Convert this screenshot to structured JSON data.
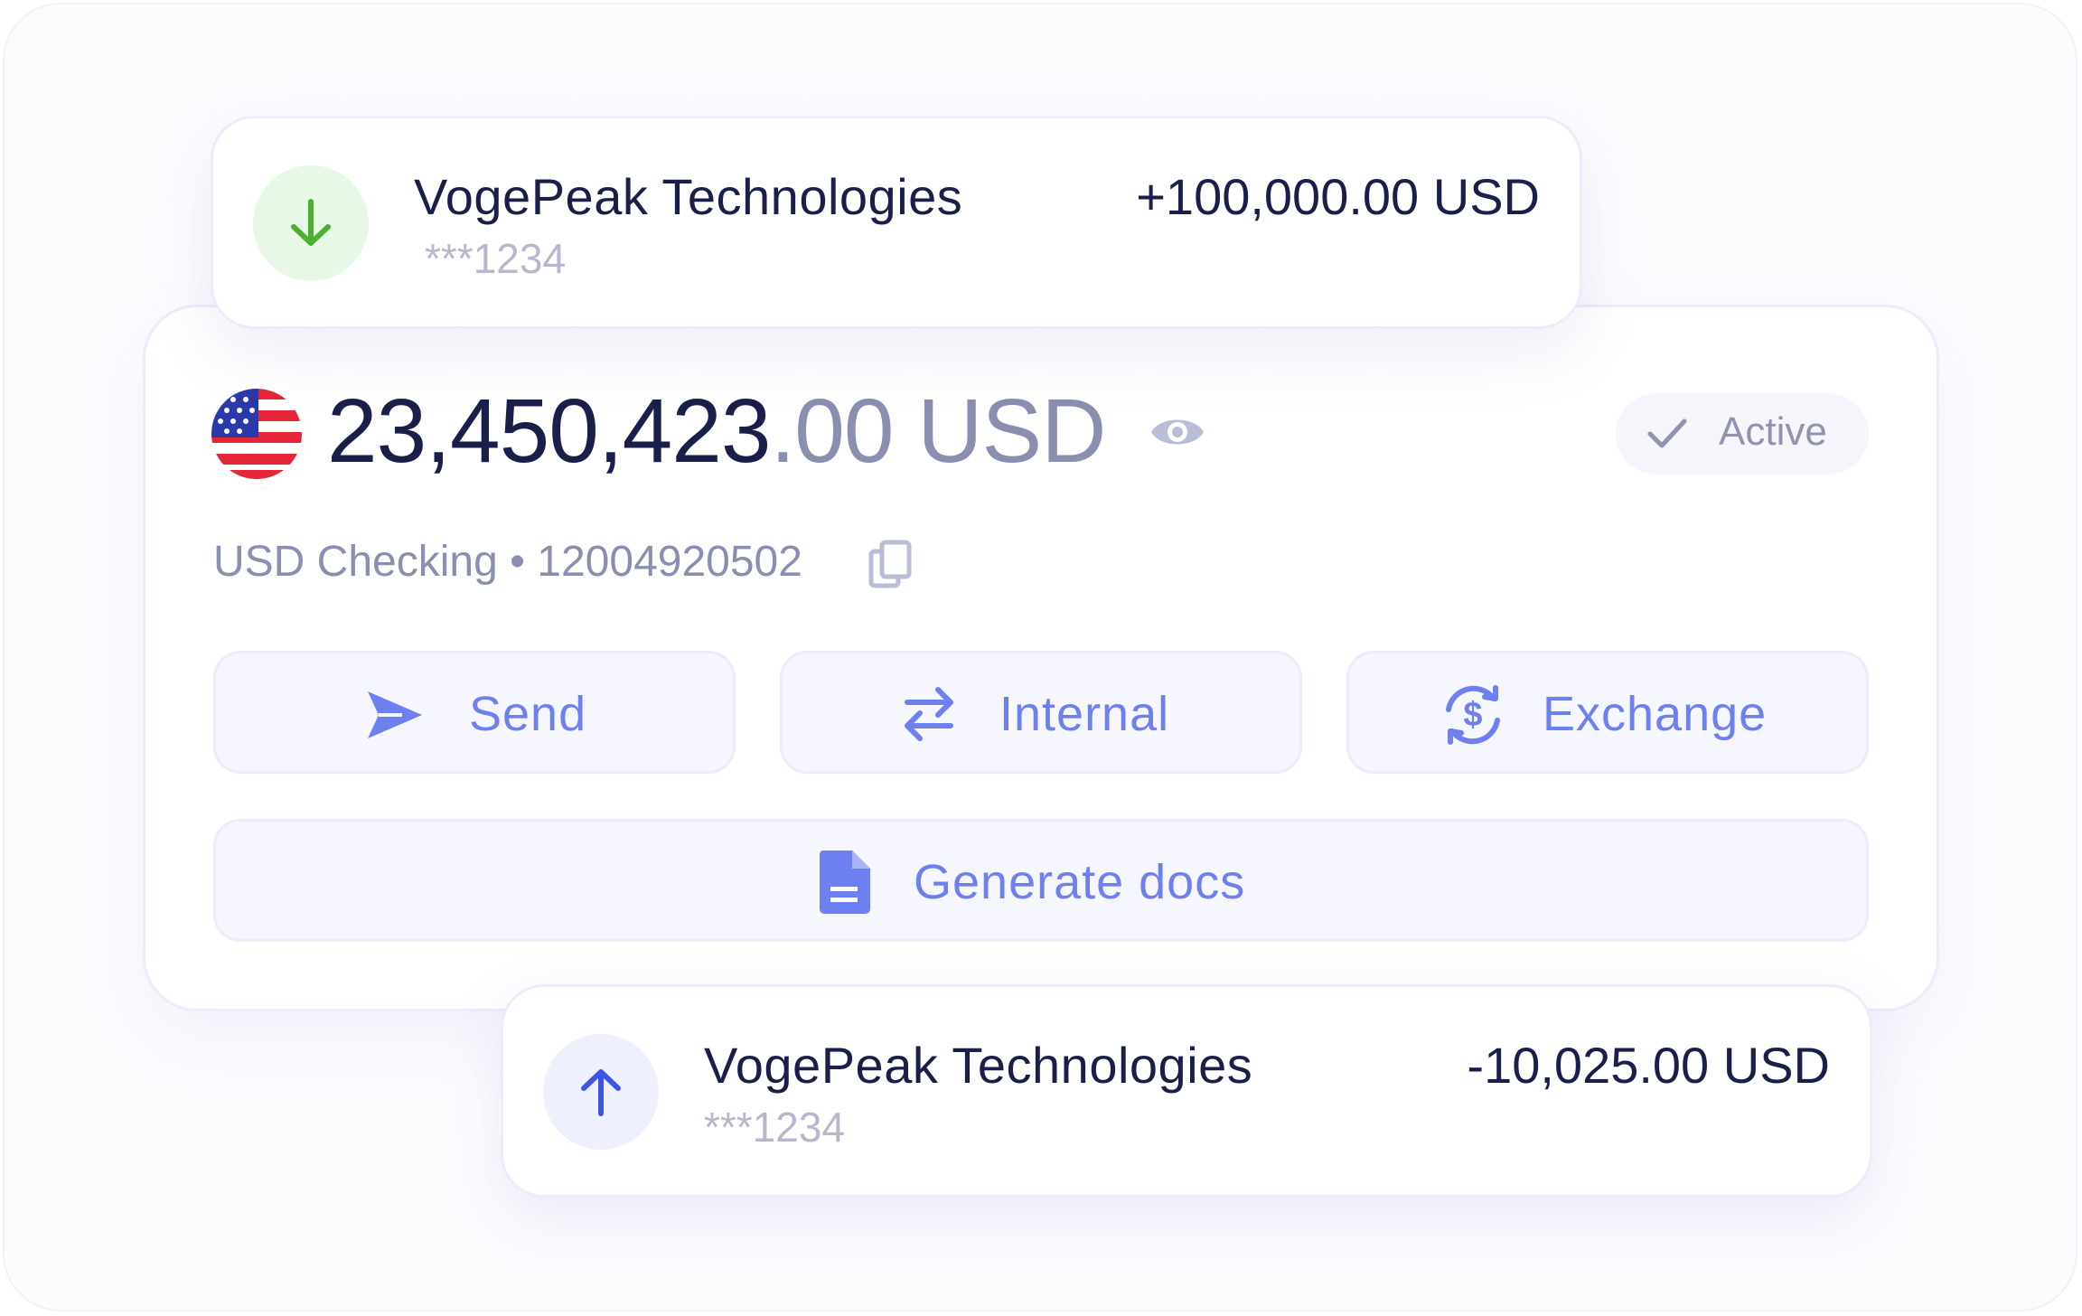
{
  "incoming_txn": {
    "name": "VogePeak Technologies",
    "account": "***1234",
    "amount": "+100,000.00 USD",
    "direction_icon": "arrow-down-icon",
    "accent": "#4caf30",
    "icon_bg": "#e8f8e6"
  },
  "account": {
    "flag_icon": "us-flag-icon",
    "balance_int": "23,450,423",
    "balance_dec": ".00 USD",
    "status": "Active",
    "name": "USD Checking",
    "separator": " • ",
    "number": "12004920502"
  },
  "actions": {
    "send": "Send",
    "internal": "Internal",
    "exchange": "Exchange",
    "generate_docs": "Generate docs"
  },
  "outgoing_txn": {
    "name": "VogePeak Technologies",
    "account": "***1234",
    "amount": "-10,025.00 USD",
    "direction_icon": "arrow-up-icon",
    "accent": "#3b55e6",
    "icon_bg": "#eef0fd"
  },
  "colors": {
    "primary_text": "#1a1f4a",
    "muted_text": "#8a8fb0",
    "action_blue": "#6e7ff0"
  }
}
